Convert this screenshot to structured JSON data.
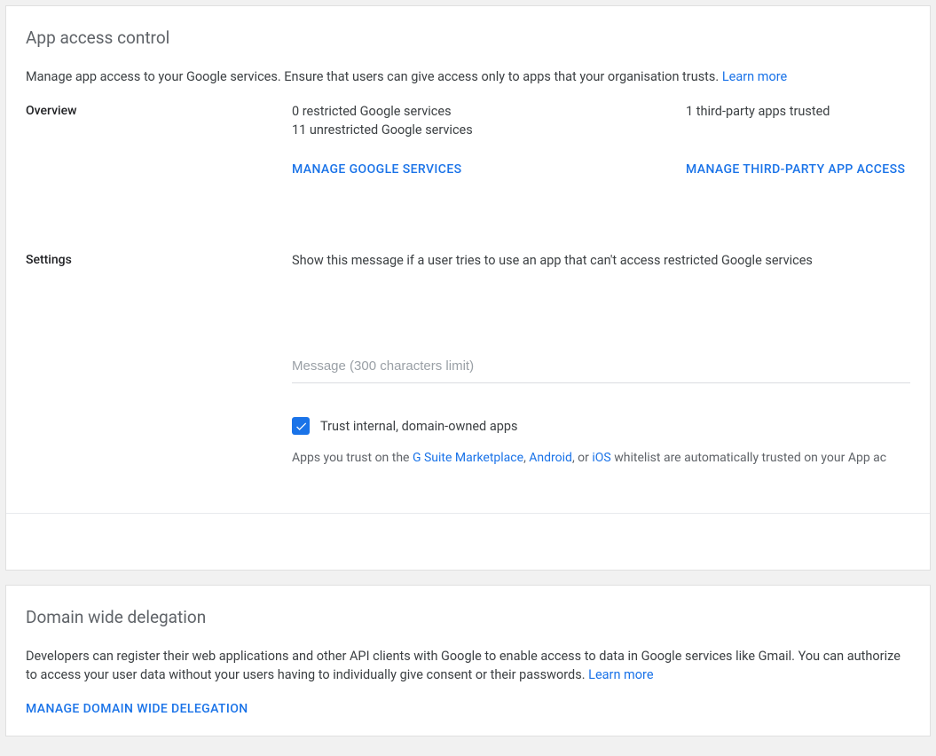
{
  "card1": {
    "title": "App access control",
    "subtitle_a": "Manage app access to your Google services. Ensure that users can give access only to apps that your organisation trusts. ",
    "subtitle_link": "Learn more",
    "overview_label": "Overview",
    "restricted": "0 restricted Google services",
    "unrestricted": "11 unrestricted Google services",
    "manage_services": "MANAGE GOOGLE SERVICES",
    "trusted": "1 third-party apps trusted",
    "manage_third_party": "MANAGE THIRD-PARTY APP ACCESS",
    "settings_label": "Settings",
    "settings_desc": "Show this message if a user tries to use an app that can't access restricted Google services",
    "msg_placeholder": "Message (300 characters limit)",
    "trust_internal": "Trust internal, domain-owned apps",
    "hint_a": "Apps you trust on the ",
    "hint_link1": "G Suite Marketplace",
    "hint_sep1": ", ",
    "hint_link2": "Android",
    "hint_sep2": ", or ",
    "hint_link3": "iOS",
    "hint_b": " whitelist are automatically trusted on your App ac"
  },
  "card2": {
    "title": "Domain wide delegation",
    "subtitle_a": "Developers can register their web applications and other API clients with Google to enable access to data in Google services like Gmail. You can authorize to access your user data without your users having to individually give consent or their passwords. ",
    "subtitle_link": "Learn more",
    "manage": "MANAGE DOMAIN WIDE DELEGATION"
  }
}
